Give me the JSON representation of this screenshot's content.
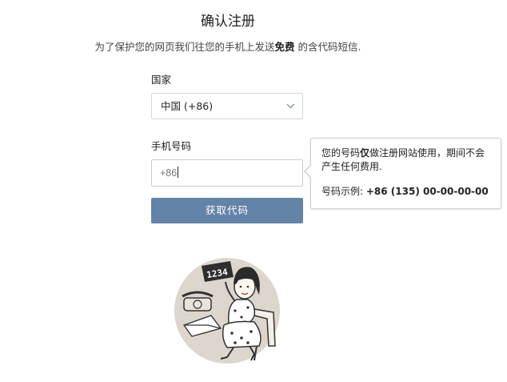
{
  "header": {
    "title": "确认注册",
    "subtitle_before": "为了保护您的网页我们往您的手机上发送",
    "subtitle_bold": "免费",
    "subtitle_after": " 的含代码短信."
  },
  "form": {
    "country_label": "国家",
    "country_value": "中国 (+86)",
    "phone_label": "手机号码",
    "phone_value": "+86",
    "submit_label": "获取代码"
  },
  "tooltip": {
    "line1_before": "您的号码",
    "line1_bold": "仅",
    "line1_after": "做注册网站使用，期间不会产生任何费用.",
    "example_label": "号码示例: ",
    "example_value": "+86 (135) 00-00-00-00"
  },
  "illustration": {
    "sign_text": "1234"
  },
  "colors": {
    "button_bg": "#6383a8",
    "circle_bg": "#dcd6cc"
  }
}
